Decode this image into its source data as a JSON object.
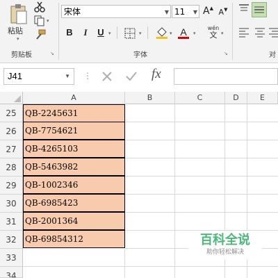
{
  "ribbon": {
    "clipboard": {
      "paste_label": "粘贴",
      "group_label": "剪贴板"
    },
    "font": {
      "font_name": "宋体",
      "font_size": "11",
      "grow_label": "A",
      "shrink_label": "A",
      "bold": "B",
      "italic": "I",
      "underline": "U",
      "font_color_letter": "A",
      "phonetic_label": "wén",
      "phonetic_glyph": "文",
      "group_label": "字体"
    },
    "alignment": {
      "group_label_partial": "对"
    }
  },
  "formula_bar": {
    "name_box": "J41",
    "fx_label": "fx",
    "formula": ""
  },
  "columns": [
    "A",
    "B",
    "C",
    "D",
    "E"
  ],
  "rows": [
    {
      "num": "25",
      "a": "QB-2245631"
    },
    {
      "num": "26",
      "a": "QB-7754621"
    },
    {
      "num": "27",
      "a": "QB-4265103"
    },
    {
      "num": "28",
      "a": "QB-5463982"
    },
    {
      "num": "29",
      "a": "QB-1002346"
    },
    {
      "num": "30",
      "a": "QB-6985423"
    },
    {
      "num": "31",
      "a": "QB-2001364"
    },
    {
      "num": "32",
      "a": "QB-69854312"
    },
    {
      "num": "33",
      "a": ""
    },
    {
      "num": "34",
      "a": ""
    }
  ],
  "colors": {
    "cell_fill": "#f8cbad",
    "watermark_green": "#3cb371"
  },
  "watermark": {
    "title": "百科全说",
    "subtitle": "助你轻松解决"
  }
}
